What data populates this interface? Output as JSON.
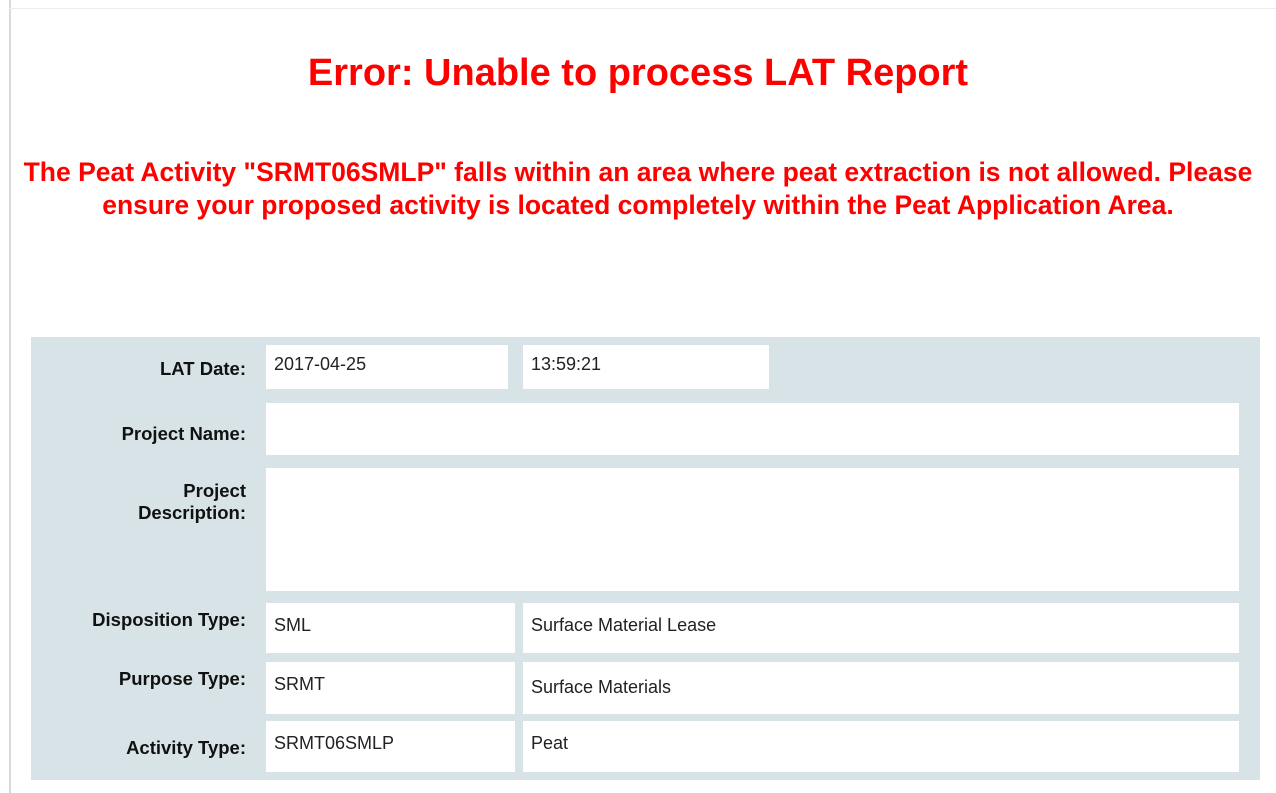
{
  "error": {
    "title": "Error: Unable to process LAT Report",
    "message": "The Peat Activity \"SRMT06SMLP\" falls within an area where peat extraction is not allowed. Please ensure your proposed activity is located completely within the Peat Application Area."
  },
  "form": {
    "lat_date_label": "LAT Date:",
    "lat_date_value": "2017-04-25",
    "lat_time_value": "13:59:21",
    "project_name_label": "Project Name:",
    "project_name_value": "",
    "project_description_label_line1": "Project",
    "project_description_label_line2": "Description:",
    "project_description_value": "",
    "disposition_type_label": "Disposition Type:",
    "disposition_type_code": "SML",
    "disposition_type_name": "Surface Material Lease",
    "purpose_type_label": "Purpose Type:",
    "purpose_type_code": "SRMT",
    "purpose_type_name": "Surface Materials",
    "activity_type_label": "Activity Type:",
    "activity_type_code": "SRMT06SMLP",
    "activity_type_name": "Peat"
  },
  "colors": {
    "error_text": "#ff0000",
    "panel_background": "#d7e3e6",
    "field_background": "#ffffff"
  }
}
